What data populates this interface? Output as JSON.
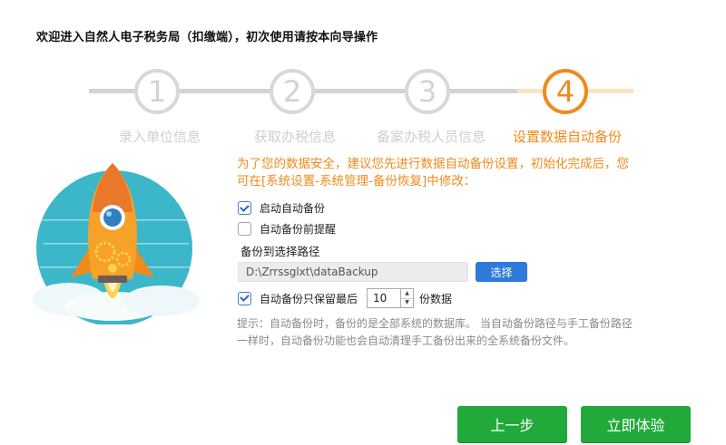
{
  "header": {
    "welcome": "欢迎进入自然人电子税务局（扣缴端），初次使用请按本向导操作"
  },
  "steps": [
    {
      "number": "1",
      "label": "录入单位信息",
      "active": false
    },
    {
      "number": "2",
      "label": "获取办税信息",
      "active": false
    },
    {
      "number": "3",
      "label": "备案办税人员信息",
      "active": false
    },
    {
      "number": "4",
      "label": "设置数据自动备份",
      "active": true
    }
  ],
  "colors": {
    "accent": "#f08a1c",
    "inactive": "#d8d8d8",
    "primary_button": "#21a93a",
    "select_button": "#2e7ad8"
  },
  "content": {
    "intro": "为了您的数据安全，建议您先进行数据自动备份设置，初始化完成后，您可在[系统设置-系统管理-备份恢复]中修改：",
    "auto_backup": {
      "label": "启动自动备份",
      "checked": true
    },
    "remind_before": {
      "label": "自动备份前提醒",
      "checked": false
    },
    "path_title": "备份到选择路径",
    "path_value": "D:\\Zrrssglxt\\dataBackup",
    "select_label": "选择",
    "keep_latest": {
      "label": "自动备份只保留最后",
      "checked": true,
      "value": "10",
      "suffix": "份数据"
    },
    "hint": "提示：自动备份时，备份的是全部系统的数据库。 当自动备份路径与手工备份路径一样时，自动备份功能也会自动清理手工备份出来的全系统备份文件。"
  },
  "footer": {
    "prev_label": "上一步",
    "start_label": "立即体验"
  }
}
